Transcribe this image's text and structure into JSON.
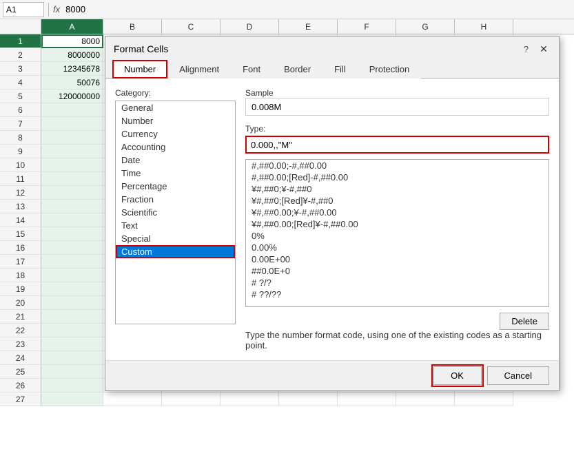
{
  "cellRef": "A1",
  "formulaValue": "8000",
  "columns": [
    {
      "label": "A",
      "width": 90
    },
    {
      "label": "B",
      "width": 85
    },
    {
      "label": "C",
      "width": 85
    },
    {
      "label": "D",
      "width": 85
    },
    {
      "label": "E",
      "width": 85
    },
    {
      "label": "F",
      "width": 85
    },
    {
      "label": "G",
      "width": 85
    },
    {
      "label": "H",
      "width": 85
    }
  ],
  "rows": [
    {
      "num": 1,
      "cells": [
        "8000",
        "",
        "",
        "",
        "",
        "",
        "",
        ""
      ]
    },
    {
      "num": 2,
      "cells": [
        "8000000",
        "",
        "",
        "",
        "",
        "",
        "",
        ""
      ]
    },
    {
      "num": 3,
      "cells": [
        "12345678",
        "",
        "",
        "",
        "",
        "",
        "",
        ""
      ]
    },
    {
      "num": 4,
      "cells": [
        "50076",
        "",
        "",
        "",
        "",
        "",
        "",
        ""
      ]
    },
    {
      "num": 5,
      "cells": [
        "120000000",
        "",
        "",
        "",
        "",
        "",
        "",
        ""
      ]
    },
    {
      "num": 6,
      "cells": [
        "",
        "",
        "",
        "",
        "",
        "",
        "",
        ""
      ]
    },
    {
      "num": 7,
      "cells": [
        "",
        "",
        "",
        "",
        "",
        "",
        "",
        ""
      ]
    },
    {
      "num": 8,
      "cells": [
        "",
        "",
        "",
        "",
        "",
        "",
        "",
        ""
      ]
    },
    {
      "num": 9,
      "cells": [
        "",
        "",
        "",
        "",
        "",
        "",
        "",
        ""
      ]
    },
    {
      "num": 10,
      "cells": [
        "",
        "",
        "",
        "",
        "",
        "",
        "",
        ""
      ]
    },
    {
      "num": 11,
      "cells": [
        "",
        "",
        "",
        "",
        "",
        "",
        "",
        ""
      ]
    },
    {
      "num": 12,
      "cells": [
        "",
        "",
        "",
        "",
        "",
        "",
        "",
        ""
      ]
    },
    {
      "num": 13,
      "cells": [
        "",
        "",
        "",
        "",
        "",
        "",
        "",
        ""
      ]
    },
    {
      "num": 14,
      "cells": [
        "",
        "",
        "",
        "",
        "",
        "",
        "",
        ""
      ]
    },
    {
      "num": 15,
      "cells": [
        "",
        "",
        "",
        "",
        "",
        "",
        "",
        ""
      ]
    },
    {
      "num": 16,
      "cells": [
        "",
        "",
        "",
        "",
        "",
        "",
        "",
        ""
      ]
    },
    {
      "num": 17,
      "cells": [
        "",
        "",
        "",
        "",
        "",
        "",
        "",
        ""
      ]
    },
    {
      "num": 18,
      "cells": [
        "",
        "",
        "",
        "",
        "",
        "",
        "",
        ""
      ]
    },
    {
      "num": 19,
      "cells": [
        "",
        "",
        "",
        "",
        "",
        "",
        "",
        ""
      ]
    },
    {
      "num": 20,
      "cells": [
        "",
        "",
        "",
        "",
        "",
        "",
        "",
        ""
      ]
    },
    {
      "num": 21,
      "cells": [
        "",
        "",
        "",
        "",
        "",
        "",
        "",
        ""
      ]
    },
    {
      "num": 22,
      "cells": [
        "",
        "",
        "",
        "",
        "",
        "",
        "",
        ""
      ]
    },
    {
      "num": 23,
      "cells": [
        "",
        "",
        "",
        "",
        "",
        "",
        "",
        ""
      ]
    },
    {
      "num": 24,
      "cells": [
        "",
        "",
        "",
        "",
        "",
        "",
        "",
        ""
      ]
    },
    {
      "num": 25,
      "cells": [
        "",
        "",
        "",
        "",
        "",
        "",
        "",
        ""
      ]
    },
    {
      "num": 26,
      "cells": [
        "",
        "",
        "",
        "",
        "",
        "",
        "",
        ""
      ]
    },
    {
      "num": 27,
      "cells": [
        "",
        "",
        "",
        "",
        "",
        "",
        "",
        ""
      ]
    }
  ],
  "dialog": {
    "title": "Format Cells",
    "tabs": [
      "Number",
      "Alignment",
      "Font",
      "Border",
      "Fill",
      "Protection"
    ],
    "activeTab": "Number",
    "categoryLabel": "Category:",
    "categories": [
      "General",
      "Number",
      "Currency",
      "Accounting",
      "Date",
      "Time",
      "Percentage",
      "Fraction",
      "Scientific",
      "Text",
      "Special",
      "Custom"
    ],
    "selectedCategory": "Custom",
    "sampleLabel": "Sample",
    "sampleValue": "0.008M",
    "typeLabel": "Type:",
    "typeValue": "0.000,,\"M\"",
    "formatCodes": [
      "#,##0.00;-#,##0.00",
      "#,##0.00;[Red]-#,##0.00",
      "¥#,##0;¥-#,##0",
      "¥#,##0;[Red]¥-#,##0",
      "¥#,##0.00;¥-#,##0.00",
      "¥#,##0.00;[Red]¥-#,##0.00",
      "0%",
      "0.00%",
      "0.00E+00",
      "##0.0E+0",
      "# ?/?",
      "# ??/??"
    ],
    "deleteLabel": "Delete",
    "descriptionText": "Type the number format code, using one of the existing codes as a starting point.",
    "okLabel": "OK",
    "cancelLabel": "Cancel"
  }
}
